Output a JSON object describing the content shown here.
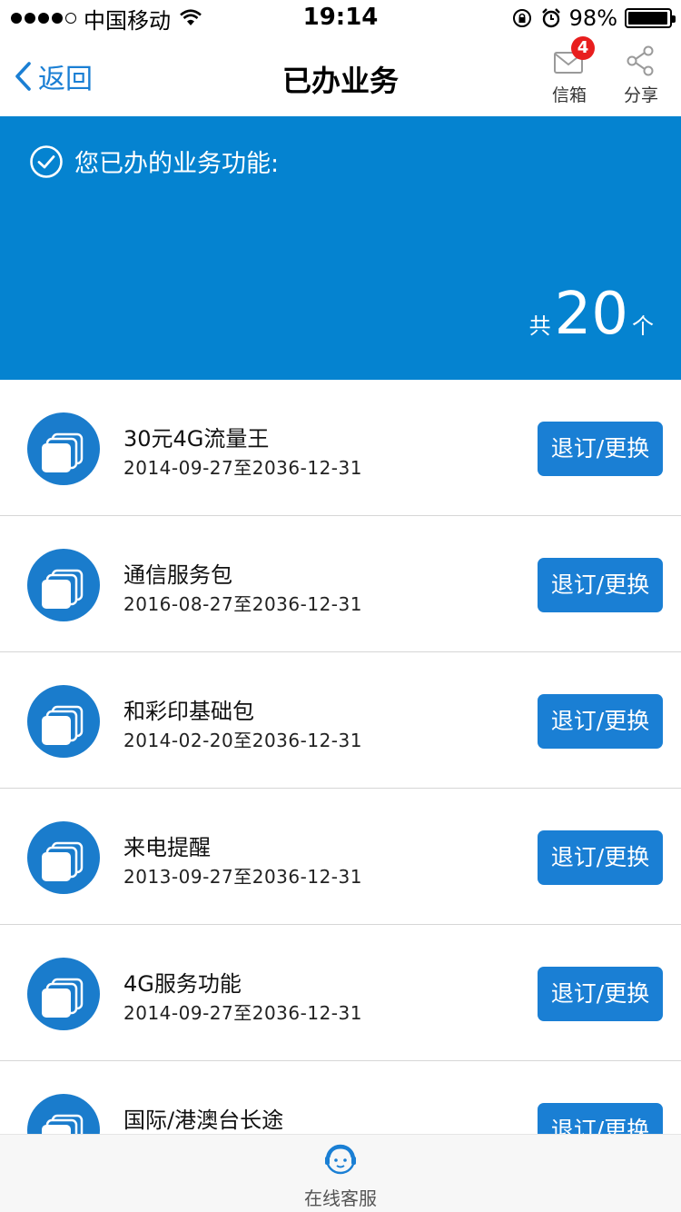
{
  "status_bar": {
    "carrier": "中国移动",
    "time": "19:14",
    "battery_percent": "98%",
    "battery_level": 0.98,
    "signal_bars_filled": 4,
    "signal_bars_total": 5
  },
  "nav": {
    "back_label": "返回",
    "title": "已办业务",
    "mailbox_label": "信箱",
    "mailbox_badge": "4",
    "share_label": "分享"
  },
  "banner": {
    "title": "您已办的业务功能:",
    "count_prefix": "共",
    "count": "20",
    "count_suffix": "个"
  },
  "services": [
    {
      "name": "30元4G流量王",
      "period": "2014-09-27至2036-12-31",
      "action": "退订/更换"
    },
    {
      "name": "通信服务包",
      "period": "2016-08-27至2036-12-31",
      "action": "退订/更换"
    },
    {
      "name": "和彩印基础包",
      "period": "2014-02-20至2036-12-31",
      "action": "退订/更换"
    },
    {
      "name": "来电提醒",
      "period": "2013-09-27至2036-12-31",
      "action": "退订/更换"
    },
    {
      "name": "4G服务功能",
      "period": "2014-09-27至2036-12-31",
      "action": "退订/更换"
    },
    {
      "name": "国际/港澳台长途",
      "period": "",
      "action": "退订/更换"
    }
  ],
  "bottom": {
    "customer_service_label": "在线客服"
  },
  "colors": {
    "accent": "#1a7fd4",
    "banner": "#0583d0",
    "badge": "#e81e1e"
  }
}
